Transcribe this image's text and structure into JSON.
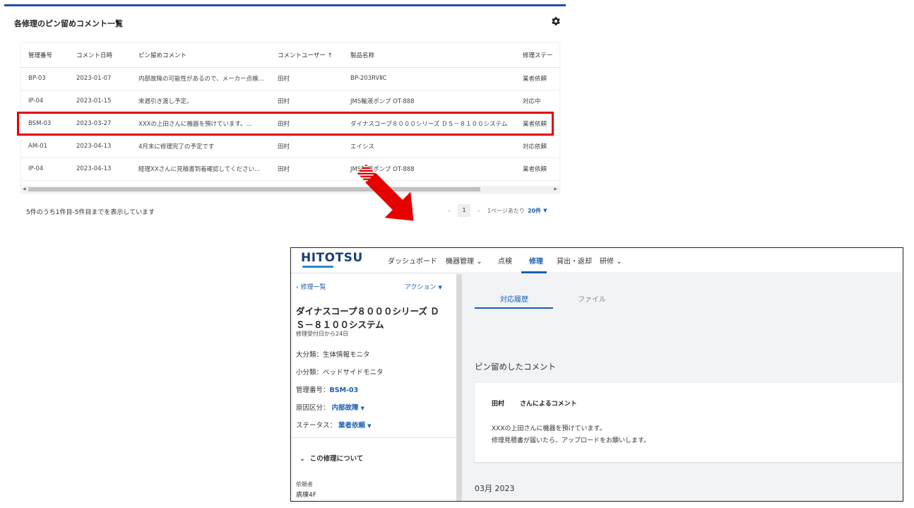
{
  "widget": {
    "title": "各修理のピン留めコメント一覧",
    "columns": [
      "管理番号",
      "コメント日時",
      "ピン留めコメント",
      "コメントユーザー ↑",
      "製品名称",
      "修理ステー"
    ],
    "rows": [
      [
        "BP-03",
        "2023-01-07",
        "内部故障の可能性があるので、メーカー点検...",
        "田村",
        "BP-203RVⅡC",
        "業者依頼"
      ],
      [
        "IP-04",
        "2023-01-15",
        "来週引き渡し予定。",
        "田村",
        "JMS輸液ポンプ OT-888",
        "対応中"
      ],
      [
        "BSM-03",
        "2023-03-27",
        "XXXの上田さんに機器を預けています。...",
        "田村",
        "ダイナスコープ８０００シリーズ ＤＳ－８１００システム",
        "業者依頼"
      ],
      [
        "AM-01",
        "2023-04-13",
        "4月末に修理完了の予定です",
        "田村",
        "エイシス",
        "対応依頼"
      ],
      [
        "IP-04",
        "2023-04-13",
        "経理XXさんに見積書到着確認してください...",
        "田村",
        "JMS輸液ポンプ OT-888",
        "業者依頼"
      ]
    ],
    "highlighted_row": 2,
    "summary": "5件のうち1件目-5件目までを表示しています",
    "pager": {
      "prev": "‹",
      "page": "1",
      "next": "›",
      "per_page_label": "1ページあたり",
      "per_page_value": "20件"
    }
  },
  "detail": {
    "logo": "HITOTSU",
    "nav": {
      "dashboard": "ダッシュボード",
      "equipment": "機器管理",
      "inspection": "点検",
      "repair": "修理",
      "lending": "貸出・返却",
      "training": "研修"
    },
    "sidebar": {
      "back": "修理一覧",
      "action": "アクション",
      "product_line1": "ダイナスコープ８０００シリーズ Ｄ",
      "product_line2": "Ｓ－８１００システム",
      "since": "修理受付日から24日",
      "major_category": "大分類：生体情報モニタ",
      "minor_category": "小分類：ベッドサイドモニタ",
      "management_label": "管理番号：",
      "management_value": "BSM-03",
      "cause_label": "原因区分：",
      "cause_value": "内部故障",
      "status_label": "ステータス：",
      "status_value": "業者依頼",
      "about": "この修理について",
      "requester_label": "依頼者",
      "requester_value": "病棟4F"
    },
    "tabs": {
      "history": "対応履歴",
      "files": "ファイル"
    },
    "pinned_title": "ピン留めしたコメント",
    "comment": {
      "user": "田村",
      "by": "さんによるコメント",
      "line1": "XXXの上田さんに機器を預けています。",
      "line2": "修理見積書が届いたら、アップロードをお願いします。"
    },
    "month": "03月 2023"
  },
  "colors": {
    "accent": "#1a5fb4",
    "highlight": "#e60000",
    "logo": "#1d3f7a"
  }
}
